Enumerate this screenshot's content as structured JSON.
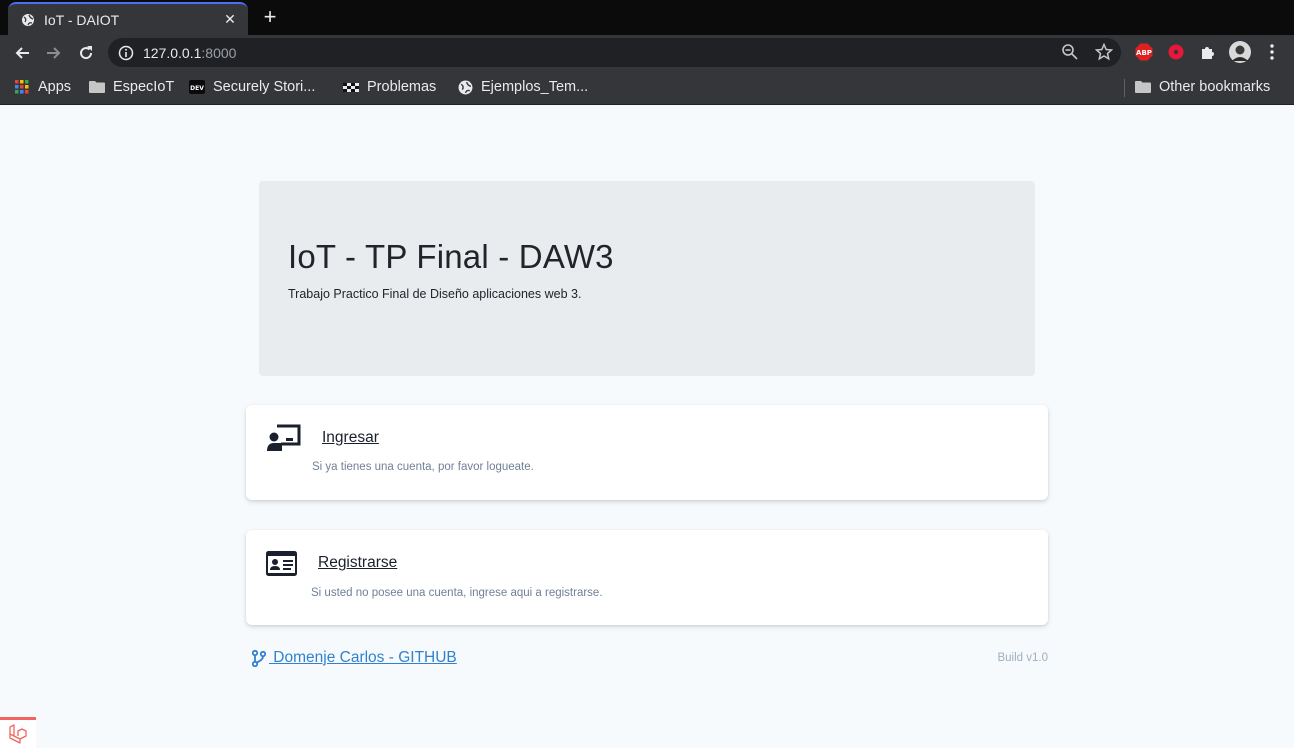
{
  "tab": {
    "title": "IoT - DAIOT",
    "close": "✕",
    "new_tab": "+"
  },
  "omnibox": {
    "host": "127.0.0.1",
    "port": ":8000"
  },
  "extensions": {
    "abp_label": "ABP"
  },
  "bookmarks": {
    "items": [
      {
        "label": "Apps",
        "icon": "apps-grid-icon"
      },
      {
        "label": "EspecIoT",
        "icon": "folder-icon"
      },
      {
        "label": "Securely Stori...",
        "icon": "dev-icon"
      },
      {
        "label": "Problemas",
        "icon": "checker-icon"
      },
      {
        "label": "Ejemplos_Tem...",
        "icon": "globe-icon"
      }
    ],
    "other": "Other bookmarks",
    "dev_badge": "DEV"
  },
  "hero": {
    "title": "IoT - TP Final - DAW3",
    "subtitle": "Trabajo Practico Final de Diseño aplicaciones web 3."
  },
  "cards": {
    "login": {
      "title": "Ingresar",
      "description": "Si ya tienes una cuenta, por favor logueate.",
      "icon": "user-presentation-icon"
    },
    "register": {
      "title": "Registrarse",
      "description": "Si usted no posee una cuenta, ingrese aqui a registrarse.",
      "icon": "id-card-icon"
    }
  },
  "footer": {
    "github_link": " Domenje Carlos - GITHUB",
    "build": "Build v1.0"
  },
  "colors": {
    "accent": "#4c6ef5",
    "link": "#3182ce",
    "laravel": "#f4645f"
  }
}
